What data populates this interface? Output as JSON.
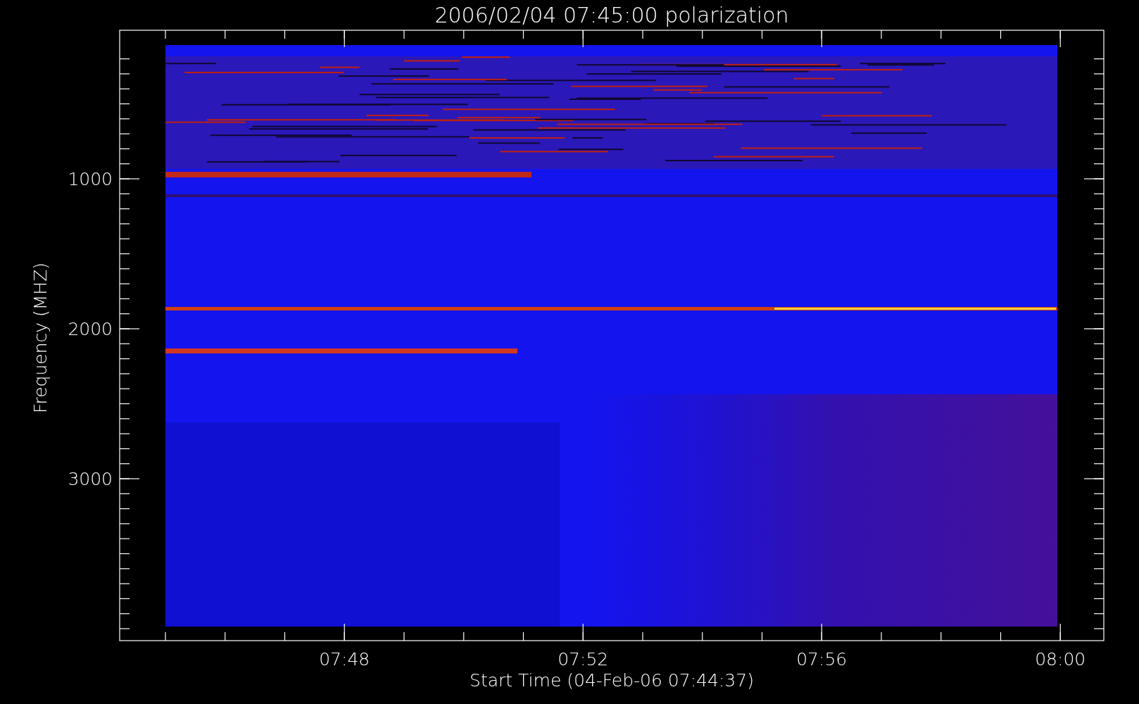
{
  "title": "2006/02/04 07:45:00 polarization",
  "y_axis": {
    "label": "Frequency (MHZ)",
    "ticks": [
      "1000",
      "2000",
      "3000"
    ]
  },
  "x_axis": {
    "label": "Start Time (04-Feb-06 07:44:37)",
    "ticks": [
      "07:48",
      "07:52",
      "07:56",
      "08:00"
    ]
  }
}
